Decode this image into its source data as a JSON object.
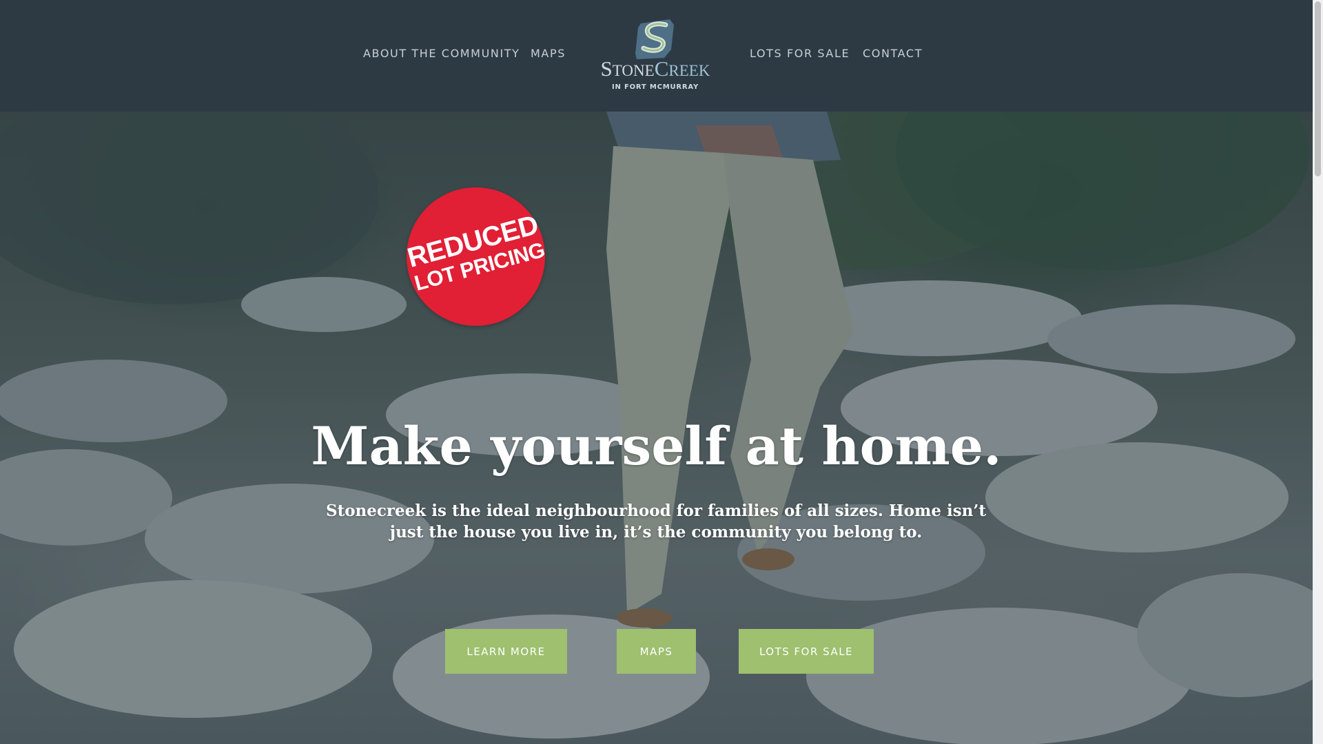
{
  "nav": {
    "left": [
      {
        "label": "ABOUT THE COMMUNITY"
      },
      {
        "label": "MAPS"
      }
    ],
    "right": [
      {
        "label": "LOTS FOR SALE"
      },
      {
        "label": "CONTACT"
      }
    ]
  },
  "logo": {
    "word_part1_initial": "S",
    "word_part1_rest": "TONE",
    "word_part2_initial": "C",
    "word_part2_rest": "REEK",
    "subtitle": "IN FORT MCMURRAY",
    "colors": {
      "primary": "#d3d9de",
      "accent": "#9dc3d3",
      "mark": "#4e6f86"
    }
  },
  "badge": {
    "line1": "REDUCED",
    "line2": "LOT PRICING",
    "color": "#e11f35"
  },
  "hero": {
    "headline": "Make yourself at home.",
    "subtext": "Stonecreek is the ideal neighbourhood for families of all sizes. Home isn’t just the house you live in, it’s the community you belong to."
  },
  "cta": {
    "learn_more": "LEARN MORE",
    "maps": "MAPS",
    "lots_for_sale": "LOTS FOR SALE",
    "color": "#9ec06f"
  },
  "theme": {
    "header_bg": "#2d3a44",
    "nav_text": "#c9d0d4"
  }
}
